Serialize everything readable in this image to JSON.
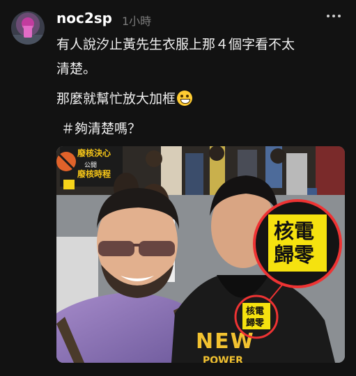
{
  "post": {
    "username": "noc2sp",
    "time": "1小時",
    "line1": "有人說汐止黃先生衣服上那４個字看不太",
    "line2": "清楚。",
    "line3": "那麼就幫忙放大加框",
    "hashtag": "＃夠清楚嗎？"
  },
  "photo": {
    "sign_top": "廢核決心",
    "sign_small": "公開",
    "sign_bottom": "廢核時程",
    "badge_text_1": "核電",
    "badge_text_2": "歸零",
    "shirt_text_1": "NEW",
    "shirt_text_2": "POWER"
  },
  "icons": {
    "more": "more-horizontal-icon",
    "emoji": "grinning-face-icon"
  }
}
